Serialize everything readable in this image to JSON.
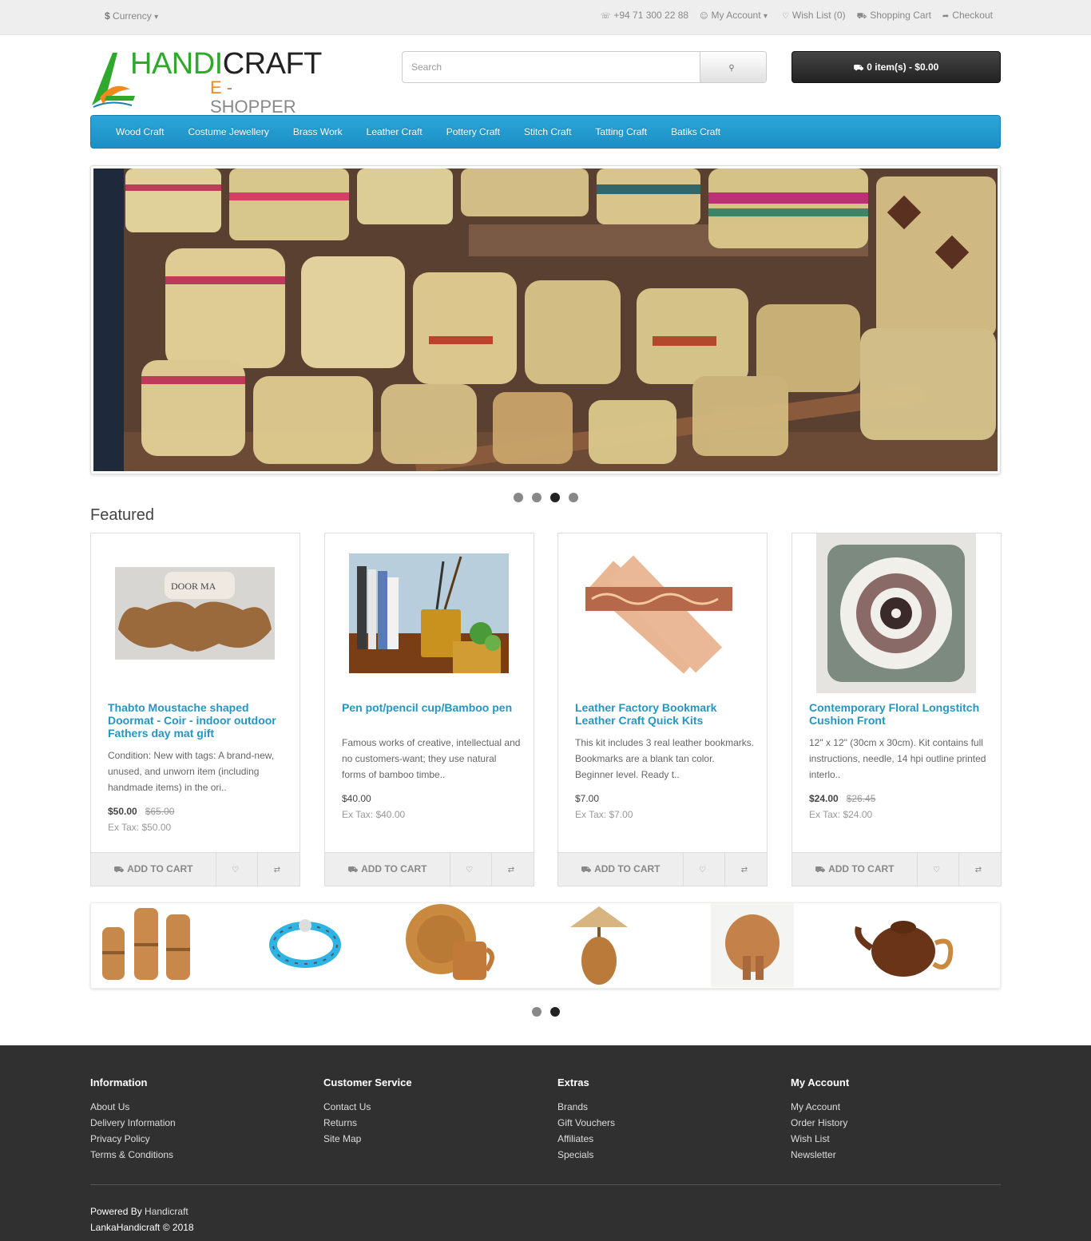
{
  "topbar": {
    "currency_symbol": "$",
    "currency_label": "Currency",
    "phone": "+94 71 300 22 88",
    "my_account": "My Account",
    "wish_list": "Wish List (0)",
    "shopping_cart": "Shopping Cart",
    "checkout": "Checkout"
  },
  "logo": {
    "part1": "HANDI",
    "part2": "CRAFT",
    "part3": "E",
    "part4": " - SHOPPER"
  },
  "search": {
    "placeholder": "Search"
  },
  "cart": {
    "label": "0 item(s) - $0.00"
  },
  "menu": [
    "Wood Craft",
    "Costume Jewellery",
    "Brass Work",
    "Leather Craft",
    "Pottery Craft",
    "Stitch Craft",
    "Tatting Craft",
    "Batiks Craft"
  ],
  "slideshow": {
    "active_index": 2,
    "count": 4
  },
  "featured": {
    "title": "Featured",
    "add_to_cart": "ADD TO CART",
    "products": [
      {
        "name": "Thabto Moustache shaped Doormat - Coir - indoor outdoor Fathers day mat gift",
        "desc": "Condition: New with tags: A brand-new, unused, and unworn item (including handmade items) in the ori..",
        "price": "$50.00",
        "old_price": "$65.00",
        "tax": "Ex Tax: $50.00",
        "image_text": "DOOR MA"
      },
      {
        "name": "Pen pot/pencil cup/Bamboo pen",
        "desc": "Famous works of creative, intellectual and no customers-want; they use natural forms of bamboo timbe..",
        "price": "$40.00",
        "old_price": "",
        "tax": "Ex Tax: $40.00"
      },
      {
        "name": "Leather Factory Bookmark Leather Craft Quick Kits",
        "desc": "This kit includes 3 real leather bookmarks. Bookmarks are a blank tan color. Beginner level. Ready t..",
        "price": "$7.00",
        "old_price": "",
        "tax": "Ex Tax: $7.00"
      },
      {
        "name": "Contemporary Floral Longstitch Cushion Front",
        "desc": "12\" x 12\" (30cm x 30cm). Kit contains full instructions, needle, 14 hpi outline printed interlo..",
        "price": "$24.00",
        "old_price": "$26.45",
        "tax": "Ex Tax: $24.00"
      }
    ]
  },
  "carousel": {
    "items": [
      "wooden-vases",
      "blue-bracelet",
      "clay-plate-cup",
      "woven-lamp",
      "wooden-elephant",
      "coconut-teapot"
    ],
    "active_index": 1,
    "count": 2
  },
  "footer": {
    "columns": [
      {
        "title": "Information",
        "links": [
          "About Us",
          "Delivery Information",
          "Privacy Policy",
          "Terms & Conditions"
        ]
      },
      {
        "title": "Customer Service",
        "links": [
          "Contact Us",
          "Returns",
          "Site Map"
        ]
      },
      {
        "title": "Extras",
        "links": [
          "Brands",
          "Gift Vouchers",
          "Affiliates",
          "Specials"
        ]
      },
      {
        "title": "My Account",
        "links": [
          "My Account",
          "Order History",
          "Wish List",
          "Newsletter"
        ]
      }
    ],
    "powered_prefix": "Powered By ",
    "powered_name": "Handicraft",
    "copyright": "LankaHandicraft © 2018"
  },
  "colors": {
    "menu": "#1f97cc",
    "link": "#2596c4",
    "footer": "#303030",
    "cart": "#2a2a2a"
  }
}
